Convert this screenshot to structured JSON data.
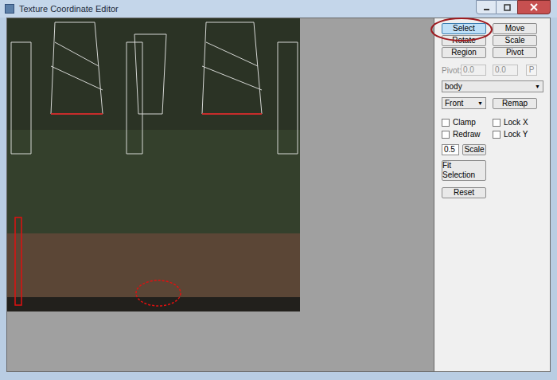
{
  "window": {
    "title": "Texture Coordinate Editor"
  },
  "tools": [
    {
      "label": "Select",
      "selected": true
    },
    {
      "label": "Move",
      "selected": false
    },
    {
      "label": "Rotate",
      "selected": false
    },
    {
      "label": "Scale",
      "selected": false
    },
    {
      "label": "Region",
      "selected": false
    },
    {
      "label": "Pivot",
      "selected": false
    }
  ],
  "pivot": {
    "label": "Pivot:",
    "x": "0.0",
    "y": "0.0",
    "button": "P",
    "disabled": true
  },
  "mesh_dropdown": {
    "value": "body",
    "arrow": "▼"
  },
  "view": {
    "dropdown": "Front",
    "arrow": "▼",
    "button": "Remap"
  },
  "options": [
    {
      "label": "Clamp",
      "checked": false
    },
    {
      "label": "Lock X",
      "checked": false
    },
    {
      "label": "Redraw",
      "checked": false
    },
    {
      "label": "Lock Y",
      "checked": false
    }
  ],
  "scale": {
    "value": "0.5",
    "button": "Scale"
  },
  "buttons": [
    "Fit Selection",
    "Reset"
  ]
}
